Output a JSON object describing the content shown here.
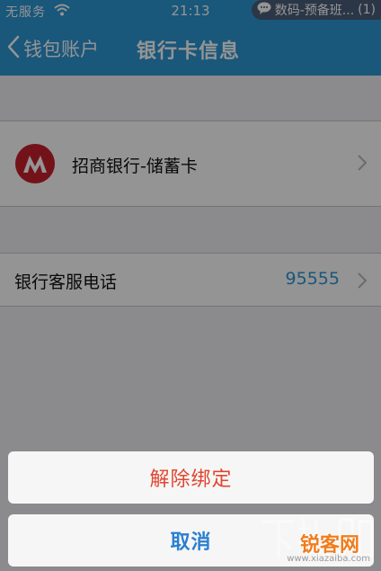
{
  "status_bar": {
    "carrier": "无服务",
    "time": "21:13",
    "notification_text": "数码-预备班...",
    "notification_count": "(1)"
  },
  "nav": {
    "back_label": "钱包账户",
    "title": "银行卡信息"
  },
  "bank_card": {
    "name": "招商银行-储蓄卡",
    "logo_icon": "cmb-bank-logo-icon",
    "logo_color": "#c8202d"
  },
  "hotline": {
    "label": "银行客服电话",
    "number": "95555"
  },
  "action_sheet": {
    "unbind_label": "解除绑定",
    "cancel_label": "取消"
  },
  "watermark": {
    "site_text": "锐客网",
    "url": "www.xiazaiba.com"
  },
  "colors": {
    "nav_blue": "#2b97d5",
    "destructive_red": "#e0452f",
    "cancel_blue": "#2b7fd0",
    "link_blue": "#2b97d5"
  }
}
